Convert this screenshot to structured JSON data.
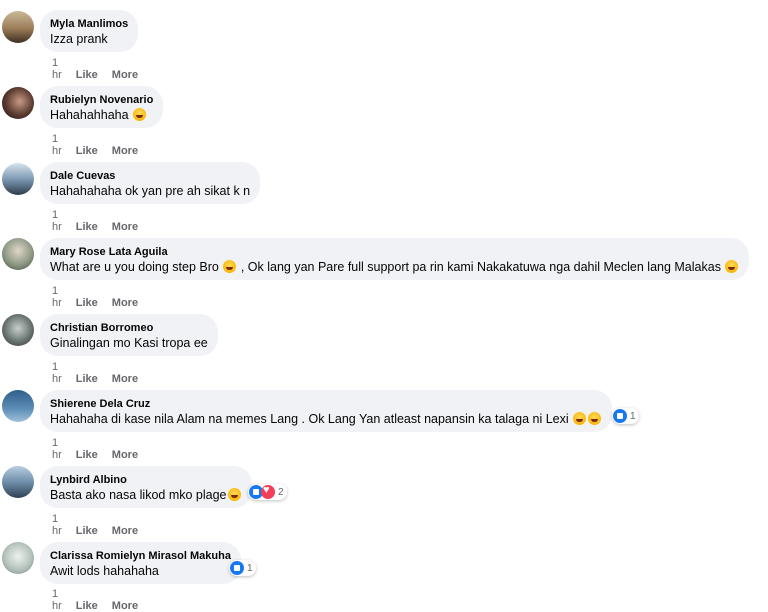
{
  "comments": [
    {
      "author": "Myla Manlimos",
      "text": "Izza prank",
      "time": "1 hr",
      "like": "Like",
      "more": "More"
    },
    {
      "author": "Rubielyn Novenario",
      "text": "Hahahahhaha",
      "time": "1 hr",
      "like": "Like",
      "more": "More"
    },
    {
      "author": "Dale Cuevas",
      "text": "Hahahahaha ok yan pre ah sikat k n",
      "time": "1 hr",
      "like": "Like",
      "more": "More"
    },
    {
      "author": "Mary Rose Lata Aguila",
      "text_a": "What are u you doing step Bro",
      "text_b": ", Ok lang yan Pare full support pa rin kami Nakakatuwa nga dahil Meclen lang Malakas",
      "time": "1 hr",
      "like": "Like",
      "more": "More"
    },
    {
      "author": "Christian Borromeo",
      "text": "Ginalingan mo Kasi tropa ee",
      "time": "1 hr",
      "like": "Like",
      "more": "More"
    },
    {
      "author": "Shierene Dela Cruz",
      "text": "Hahahaha di kase nila Alam na memes Lang . Ok Lang Yan atleast napansin ka talaga ni Lexi",
      "reaction_count": "1",
      "time": "1 hr",
      "like": "Like",
      "more": "More"
    },
    {
      "author": "Lynbird Albino",
      "text": "Basta ako nasa likod mko plage",
      "reaction_count": "2",
      "time": "1 hr",
      "like": "Like",
      "more": "More"
    },
    {
      "author": "Clarissa Romielyn Mirasol Makuha",
      "text": "Awit lods hahahaha",
      "reaction_count": "1",
      "time": "1 hr",
      "like": "Like",
      "more": "More"
    }
  ],
  "avatar_colors": [
    "#8a7a5c",
    "#3a2a24",
    "#6f8fa8",
    "#7c8a7a",
    "#5a6a66",
    "#5d7f9c",
    "#4a6a88",
    "#b9c6c0"
  ]
}
